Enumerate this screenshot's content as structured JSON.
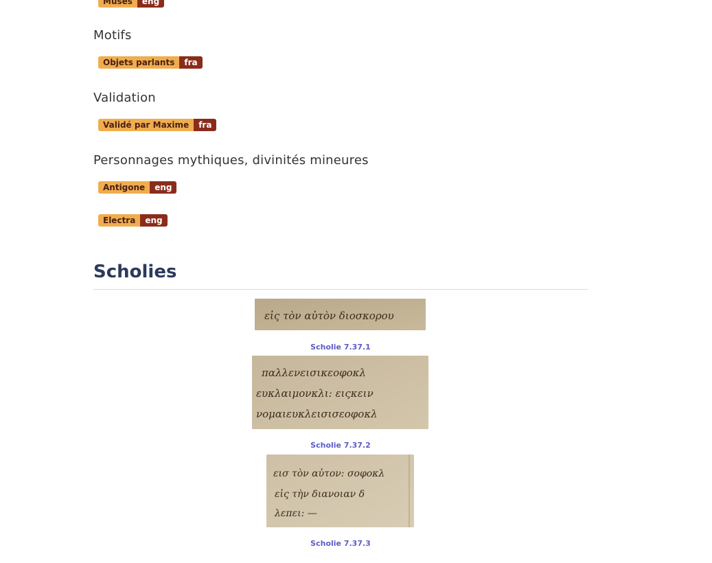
{
  "tags_top": {
    "label": "Muses",
    "lang": "eng"
  },
  "sections": [
    {
      "title": "Motifs",
      "tags": [
        {
          "label": "Objets parlants",
          "lang": "fra"
        }
      ]
    },
    {
      "title": "Validation",
      "tags": [
        {
          "label": "Validé par Maxime",
          "lang": "fra"
        }
      ]
    },
    {
      "title": "Personnages mythiques, divinités mineures",
      "tags": [
        {
          "label": "Antigone",
          "lang": "eng"
        },
        {
          "label": "Electra",
          "lang": "eng"
        }
      ]
    }
  ],
  "scholies": {
    "title": "Scholies",
    "items": [
      {
        "caption": "Scholie 7.37.1",
        "transcription": "εἰς τὸν αὐτὸν διοσκορου"
      },
      {
        "caption": "Scholie 7.37.2",
        "transcription": [
          "παλλενεισικεοφοκλ",
          "ευκλαιμονκλι: ειςκειν",
          "νομαιευκλεισισεοφοκλ"
        ]
      },
      {
        "caption": "Scholie 7.37.3",
        "transcription": [
          "εισ τὸν αὐτον: σοφοκλ",
          "εἰς τὴν διανοιαν δ",
          "λεπει: —"
        ]
      }
    ]
  },
  "colors": {
    "tag_label_bg": "#f0ad4e",
    "tag_lang_bg": "#8b2c1b",
    "title": "#2b3a5c",
    "link": "#5b5bc8"
  }
}
